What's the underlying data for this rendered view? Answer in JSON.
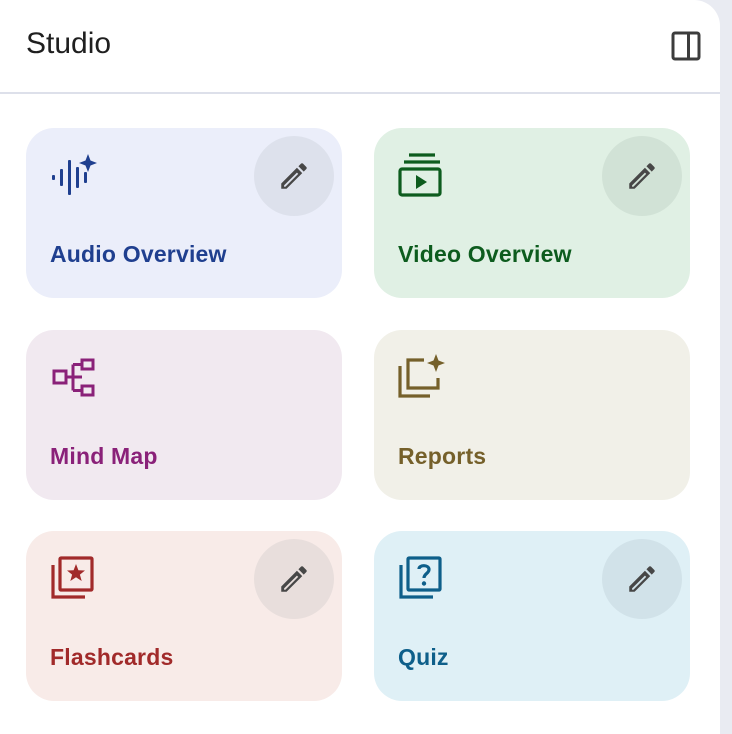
{
  "header": {
    "title": "Studio"
  },
  "cards": {
    "audio": {
      "label": "Audio Overview",
      "color": "#1f3f8f",
      "icon": "audio-waveform-sparkle-icon",
      "editable": true
    },
    "video": {
      "label": "Video Overview",
      "color": "#0d5c1e",
      "icon": "video-library-icon",
      "editable": true
    },
    "mindmap": {
      "label": "Mind Map",
      "color": "#8a2179",
      "icon": "mind-map-icon",
      "editable": false
    },
    "reports": {
      "label": "Reports",
      "color": "#75602a",
      "icon": "reports-sparkle-icon",
      "editable": false
    },
    "flash": {
      "label": "Flashcards",
      "color": "#a12a2a",
      "icon": "flashcards-star-icon",
      "editable": true
    },
    "quiz": {
      "label": "Quiz",
      "color": "#0e5f8a",
      "icon": "quiz-question-icon",
      "editable": true
    }
  },
  "colors": {
    "edit_icon": "#474747",
    "toggle_icon": "#3c3c3c"
  }
}
